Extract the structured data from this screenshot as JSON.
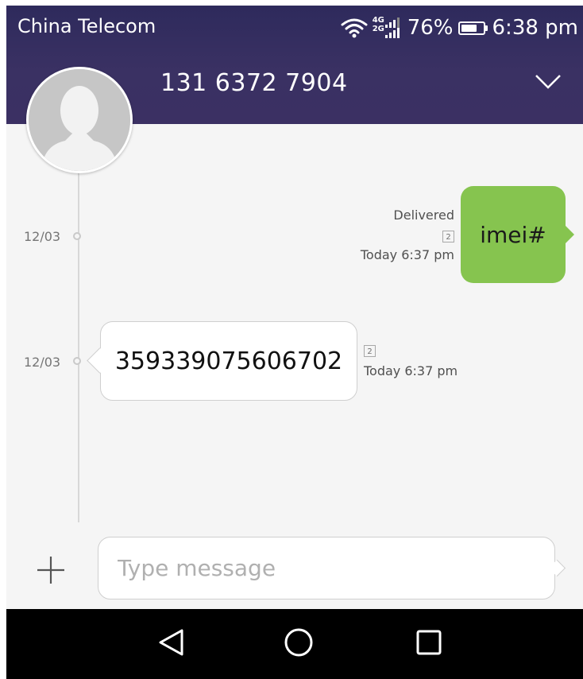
{
  "status_bar": {
    "carrier": "China Telecom",
    "network_top": "4G",
    "network_bottom": "2G",
    "battery_percent": "76%",
    "battery_level": 0.76,
    "time": "6:38 pm"
  },
  "header": {
    "contact_name": "131 6372 7904"
  },
  "messages": [
    {
      "direction": "outgoing",
      "date": "12/03",
      "text": "imei#",
      "status": "Delivered",
      "sim": "2",
      "timestamp": "Today 6:37 pm"
    },
    {
      "direction": "incoming",
      "date": "12/03",
      "text": "359339075606702",
      "sim": "2",
      "timestamp": "Today 6:37 pm"
    }
  ],
  "composer": {
    "placeholder": "Type message"
  },
  "icons": {
    "wifi": "wifi-icon",
    "signal": "signal-icon",
    "battery": "battery-icon",
    "expand": "chevron-down-icon",
    "avatar": "person-silhouette-icon",
    "add": "plus-icon",
    "back": "back-triangle-icon",
    "home": "home-circle-icon",
    "recents": "recents-square-icon"
  },
  "colors": {
    "header_bg": "#3a3163",
    "outgoing_bubble": "#86c44f",
    "incoming_bubble": "#ffffff",
    "conversation_bg": "#f5f5f5",
    "navbar_bg": "#000000"
  }
}
